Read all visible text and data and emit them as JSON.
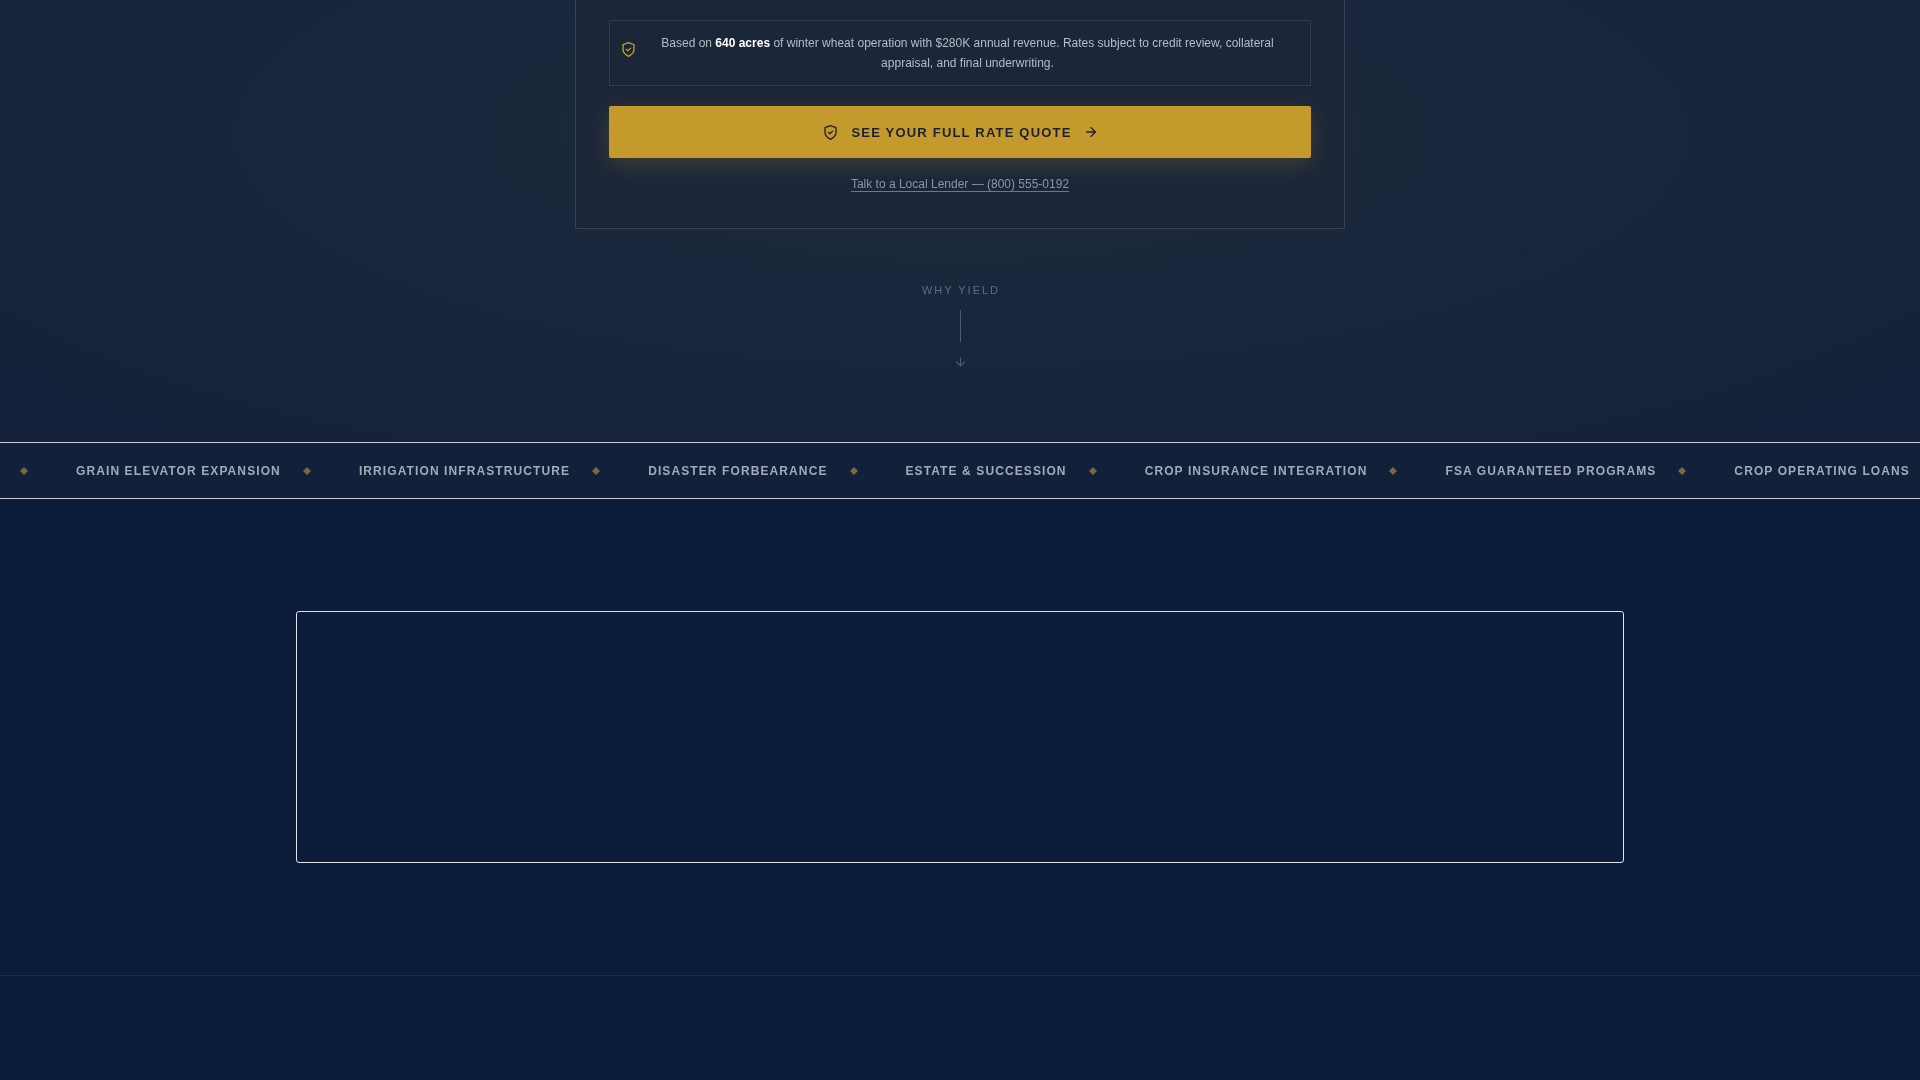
{
  "rate_card": {
    "notice": "Based on **640 acres** of winter wheat operation with $280K annual revenue. Rates subject to credit review, collateral appraisal, and final underwriting.",
    "cta_button": "SEE YOUR FULL RATE QUOTE",
    "lender_link": "Talk to a Local Lender — (800) 555-0192"
  },
  "why_section": {
    "label": "WHY YIELD"
  },
  "ticker": {
    "items": [
      "GRAIN ELEVATOR EXPANSION",
      "IRRIGATION INFRASTRUCTURE",
      "DISASTER FORBEARANCE",
      "ESTATE & SUCCESSION",
      "CROP INSURANCE INTEGRATION",
      "FSA GUARANTEED PROGRAMS",
      "CROP OPERATING LOANS"
    ]
  }
}
